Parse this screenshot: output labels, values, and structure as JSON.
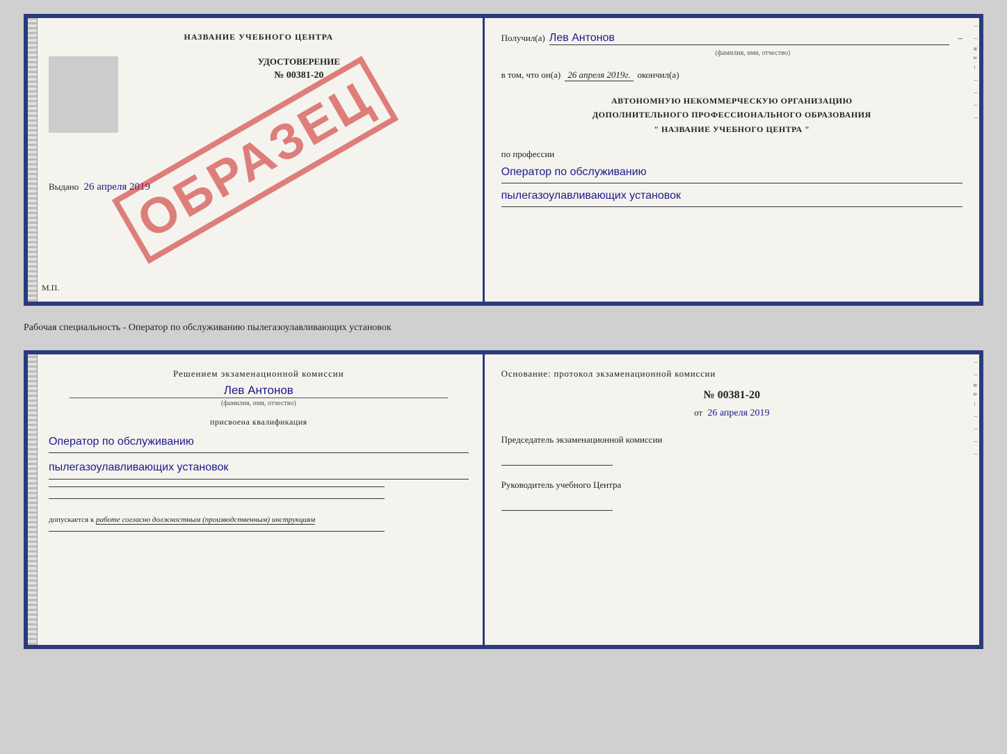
{
  "topDoc": {
    "left": {
      "trainingCenterTitle": "НАЗВАНИЕ УЧЕБНОГО ЦЕНТРА",
      "udostoverenie": "УДОСТОВЕРЕНИЕ",
      "docNumber": "№ 00381-20",
      "vydano": "Выдано",
      "vydanoDate": "26 апреля 2019",
      "mpLabel": "М.П.",
      "obrazec": "ОБРАЗЕЦ"
    },
    "right": {
      "poluchilLabel": "Получил(а)",
      "recipientName": "Лев Антонов",
      "fioSubtitle": "(фамилия, имя, отчество)",
      "vtomChtoLabel": "в том, что он(а)",
      "date": "26 апреля 2019г.",
      "okoncilLabel": "окончил(а)",
      "orgLine1": "АВТОНОМНУЮ НЕКОММЕРЧЕСКУЮ ОРГАНИЗАЦИЮ",
      "orgLine2": "ДОПОЛНИТЕЛЬНОГО ПРОФЕССИОНАЛЬНОГО ОБРАЗОВАНИЯ",
      "orgLine3": "\"   НАЗВАНИЕ УЧЕБНОГО ЦЕНТРА   \"",
      "poProfessiiLabel": "по профессии",
      "profession1": "Оператор по обслуживанию",
      "profession2": "пылегазоулавливающих установок"
    }
  },
  "middleText": "Рабочая специальность - Оператор по обслуживанию пылегазоулавливающих установок",
  "bottomDoc": {
    "left": {
      "resheniemLabel": "Решением экзаменационной комиссии",
      "name": "Лев Антонов",
      "fioSubtitle": "(фамилия, имя, отчество)",
      "prisvoenLabel": "присвоена квалификация",
      "qualification1": "Оператор по обслуживанию",
      "qualification2": "пылегазоулавливающих установок",
      "dopuskaetsyaLabel": "допускается к",
      "dopuskText": "работе согласно должностным (производственным) инструкциям"
    },
    "right": {
      "osnovanieLable": "Основание: протокол экзаменационной комиссии",
      "protocolNumber": "№ 00381-20",
      "otLabel": "от",
      "date": "26 апреля 2019",
      "predsedatelLabel": "Председатель экзаменационной комиссии",
      "rukovoditelLabel": "Руководитель учебного Центра"
    }
  }
}
